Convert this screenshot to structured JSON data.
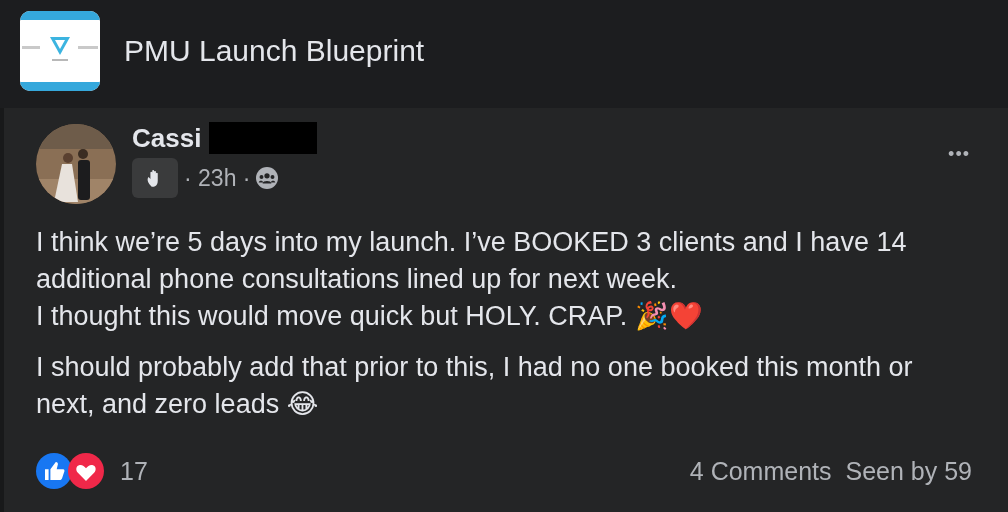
{
  "group": {
    "name": "PMU Launch Blueprint"
  },
  "post": {
    "author": "Cassi",
    "author_redacted": true,
    "time": "23h",
    "separator": "·",
    "paragraphs": [
      "I think we’re 5 days into my launch. I’ve BOOKED 3 clients and I have 14 additional phone consultations lined up for next week.\nI thought this would move quick but HOLY. CRAP. 🎉❤️",
      "I should probably add that prior to this, I had no one booked this month or next, and zero leads 😂"
    ],
    "more_button": "•••",
    "reactions_count": "17",
    "comments": "4 Comments",
    "seen_by": "Seen by 59"
  }
}
